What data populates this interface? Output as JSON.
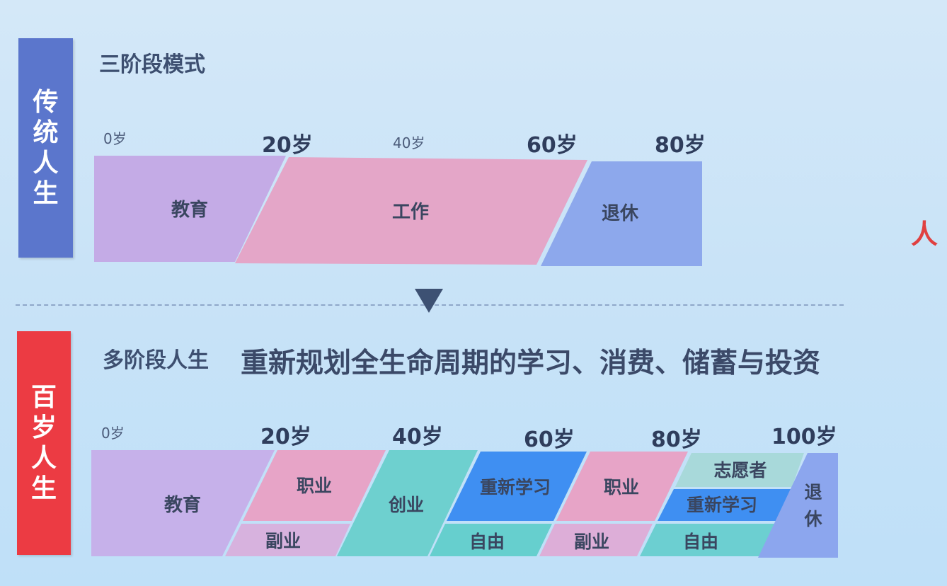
{
  "traditional": {
    "side_label": [
      "传",
      "统",
      "人",
      "生"
    ],
    "title": "三阶段模式",
    "ages": [
      {
        "text": "0岁",
        "style": "small"
      },
      {
        "text": "20岁",
        "style": "big"
      },
      {
        "text": "40岁",
        "style": "small"
      },
      {
        "text": "60岁",
        "style": "big"
      },
      {
        "text": "80岁",
        "style": "big"
      }
    ],
    "stages": [
      {
        "name": "education",
        "label": "教育",
        "color": "#c4abe6"
      },
      {
        "name": "work",
        "label": "工作",
        "color": "#e4a6c8"
      },
      {
        "name": "retire",
        "label": "退休",
        "color": "#8da8ec"
      }
    ]
  },
  "centenarian": {
    "side_label": [
      "百",
      "岁",
      "人",
      "生"
    ],
    "title": "多阶段人生",
    "headline": "重新规划全生命周期的学习、消费、储蓄与投资",
    "ages": [
      {
        "text": "0岁",
        "style": "small"
      },
      {
        "text": "20岁",
        "style": "big"
      },
      {
        "text": "40岁",
        "style": "big"
      },
      {
        "text": "60岁",
        "style": "big"
      },
      {
        "text": "80岁",
        "style": "big"
      },
      {
        "text": "100岁",
        "style": "big"
      }
    ],
    "stages": [
      {
        "name": "education",
        "label": "教育",
        "color": "#c6b1ea"
      },
      {
        "name": "career-1",
        "label": "职业",
        "color": "#e7a4c7"
      },
      {
        "name": "side-job-1",
        "label": "副业",
        "color": "#d7b2de"
      },
      {
        "name": "startup",
        "label": "创业",
        "color": "#6ed0cf"
      },
      {
        "name": "relearn-1",
        "label": "重新学习",
        "color": "#3f8ff2"
      },
      {
        "name": "freedom-1",
        "label": "自由",
        "color": "#66cfce"
      },
      {
        "name": "career-2",
        "label": "职业",
        "color": "#e7a4c7"
      },
      {
        "name": "side-job-2",
        "label": "副业",
        "color": "#ddaed8"
      },
      {
        "name": "volunteer",
        "label": "志愿者",
        "color": "#a8d9da"
      },
      {
        "name": "relearn-2",
        "label": "重新学习",
        "color": "#3f8ff2"
      },
      {
        "name": "freedom-2",
        "label": "自由",
        "color": "#6ccfd1"
      },
      {
        "name": "retire",
        "label": "退休",
        "color": "#8ca6ee"
      }
    ]
  },
  "edge_text": "人",
  "colors": {
    "traditional_side": "#5b76cc",
    "centenarian_side": "#ec3b43"
  },
  "icons": {
    "divider_arrow": "triangle-down-icon"
  }
}
